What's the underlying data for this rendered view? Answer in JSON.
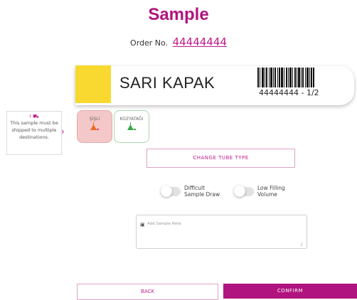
{
  "header": {
    "title": "Sample",
    "order_label": "Order No.",
    "order_number": "44444444"
  },
  "tube": {
    "cap_color": "#f9d92f",
    "name": "SARI KAPAK",
    "barcode_text": "44444444 - 1/2"
  },
  "notice": {
    "text": "This sample must be shipped to multiple destinations.",
    "icons": [
      "alert-icon",
      "truck-icon"
    ]
  },
  "destinations": [
    {
      "label": "ŞİŞLİ",
      "selected": true,
      "icon": "flask-icon"
    },
    {
      "label": "KOZYATAĞI",
      "selected": false,
      "icon": "flask-icon"
    }
  ],
  "actions": {
    "change_tube_type": "CHANGE TUBE TYPE",
    "back": "BACK",
    "confirm": "CONFIRM"
  },
  "toggles": [
    {
      "label_line1": "Difficult",
      "label_line2": "Sample Draw",
      "on": false
    },
    {
      "label_line1": "Low Filling",
      "label_line2": "Volume",
      "on": false
    }
  ],
  "note": {
    "placeholder": "Add Sample Note"
  },
  "colors": {
    "accent": "#b0147e",
    "cap": "#f9d92f",
    "selected_destination": "#f4c8c9",
    "unselected_destination_border": "#a7d9a9"
  }
}
